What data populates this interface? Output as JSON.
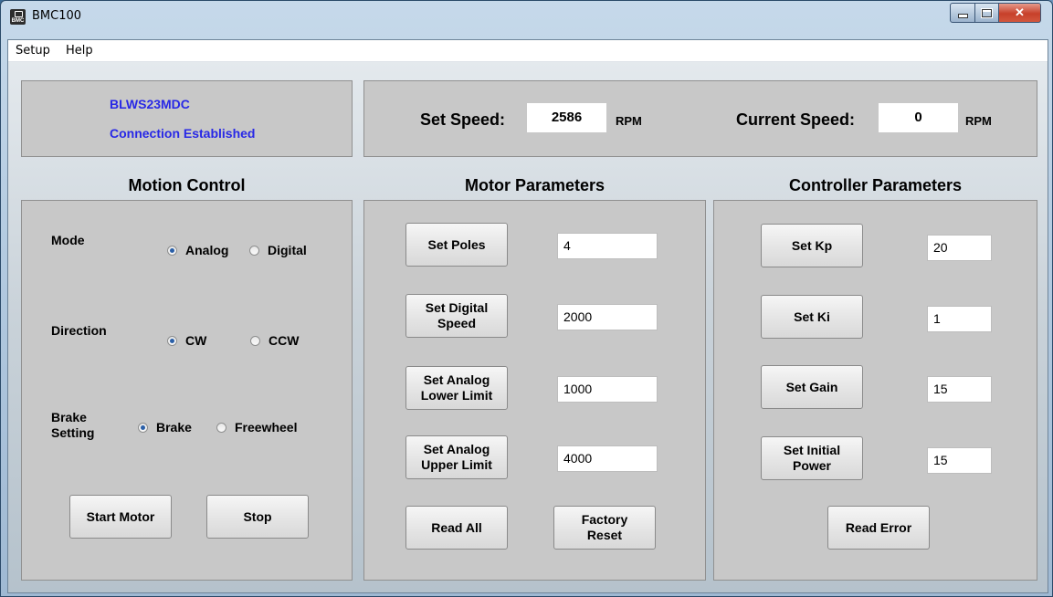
{
  "window": {
    "title": "BMC100",
    "icon_label": "BMC"
  },
  "menu": [
    "Setup",
    "Help"
  ],
  "connection": {
    "device": "BLWS23MDC",
    "status": "Connection Established"
  },
  "speed": {
    "set_label": "Set Speed:",
    "set_value": "2586",
    "set_unit": "RPM",
    "current_label": "Current Speed:",
    "current_value": "0",
    "current_unit": "RPM"
  },
  "motion_control": {
    "title": "Motion Control",
    "mode_label": "Mode",
    "mode_options": [
      "Analog",
      "Digital"
    ],
    "mode_selected": "Analog",
    "direction_label": "Direction",
    "direction_options": [
      "CW",
      "CCW"
    ],
    "direction_selected": "CW",
    "brake_label": "Brake\nSetting",
    "brake_options": [
      "Brake",
      "Freewheel"
    ],
    "brake_selected": "Brake",
    "start_label": "Start Motor",
    "stop_label": "Stop"
  },
  "motor_parameters": {
    "title": "Motor Parameters",
    "rows": [
      {
        "button": "Set Poles",
        "value": "4"
      },
      {
        "button": "Set Digital\nSpeed",
        "value": "2000"
      },
      {
        "button": "Set Analog\nLower Limit",
        "value": "1000"
      },
      {
        "button": "Set Analog\nUpper Limit",
        "value": "4000"
      }
    ],
    "read_all_label": "Read All",
    "factory_reset_label": "Factory\nReset"
  },
  "controller_parameters": {
    "title": "Controller Parameters",
    "rows": [
      {
        "button": "Set Kp",
        "value": "20"
      },
      {
        "button": "Set Ki",
        "value": "1"
      },
      {
        "button": "Set Gain",
        "value": "15"
      },
      {
        "button": "Set Initial\nPower",
        "value": "15"
      }
    ],
    "read_error_label": "Read Error"
  }
}
